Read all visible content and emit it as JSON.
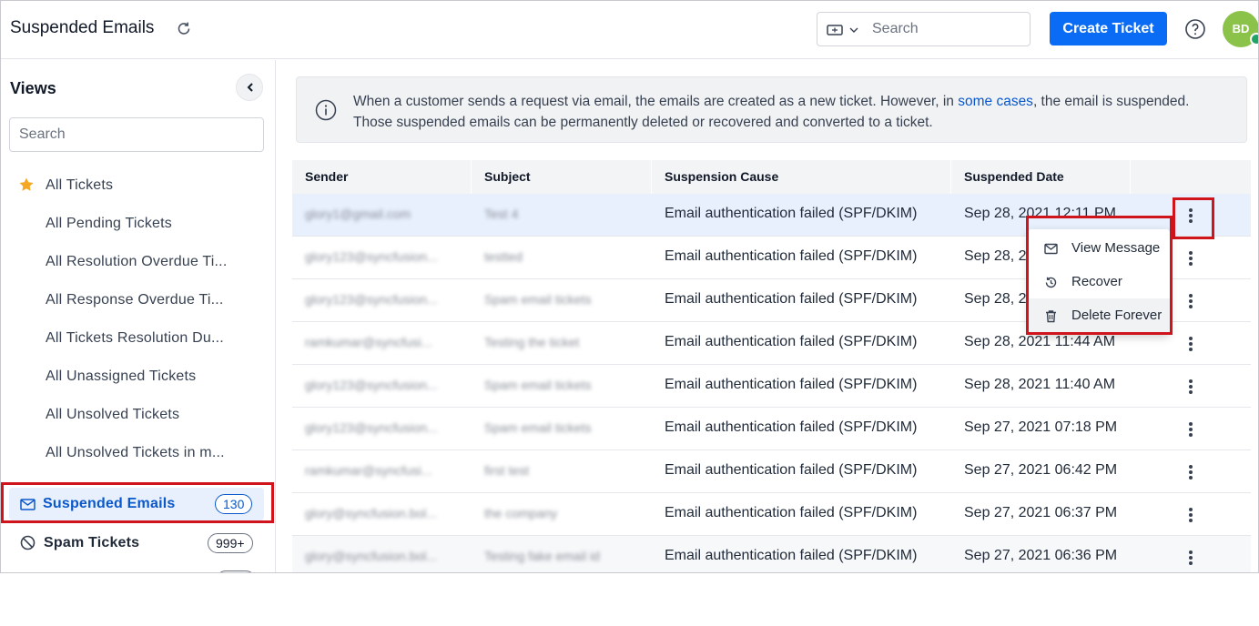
{
  "header": {
    "title": "Suspended Emails",
    "search_placeholder": "Search",
    "create_ticket_label": "Create Ticket",
    "avatar_initials": "BD"
  },
  "sidebar": {
    "views_title": "Views",
    "search_placeholder": "Search",
    "items": [
      {
        "label": "All Tickets"
      },
      {
        "label": "All Pending Tickets"
      },
      {
        "label": "All Resolution Overdue Ti..."
      },
      {
        "label": "All Response Overdue Ti..."
      },
      {
        "label": "All Tickets Resolution Du..."
      },
      {
        "label": "All Unassigned Tickets"
      },
      {
        "label": "All Unsolved Tickets"
      },
      {
        "label": "All Unsolved Tickets in m..."
      }
    ],
    "suspended": {
      "label": "Suspended Emails",
      "count": "130"
    },
    "spam": {
      "label": "Spam Tickets",
      "count": "999+"
    }
  },
  "info": {
    "text_before": "When a customer sends a request via email, the emails are created as a new ticket. However, in ",
    "link_text": "some cases",
    "text_after": ", the email is suspended. Those suspended emails can be permanently deleted or recovered and converted to a ticket."
  },
  "table": {
    "headers": {
      "sender": "Sender",
      "subject": "Subject",
      "cause": "Suspension Cause",
      "date": "Suspended Date"
    },
    "rows": [
      {
        "sender": "glory1@gmail.com",
        "subject": "Test 4",
        "cause": "Email authentication failed (SPF/DKIM)",
        "date": "Sep 28, 2021 12:11 PM"
      },
      {
        "sender": "glory123@syncfusion...",
        "subject": "testted",
        "cause": "Email authentication failed (SPF/DKIM)",
        "date": "Sep 28, 2021 12:05 PM"
      },
      {
        "sender": "glory123@syncfusion...",
        "subject": "Spam email tickets",
        "cause": "Email authentication failed (SPF/DKIM)",
        "date": "Sep 28, 2021 11:52 AM"
      },
      {
        "sender": "ramkumar@syncfusi...",
        "subject": "Testing the ticket",
        "cause": "Email authentication failed (SPF/DKIM)",
        "date": "Sep 28, 2021 11:44 AM"
      },
      {
        "sender": "glory123@syncfusion...",
        "subject": "Spam email tickets",
        "cause": "Email authentication failed (SPF/DKIM)",
        "date": "Sep 28, 2021 11:40 AM"
      },
      {
        "sender": "glory123@syncfusion...",
        "subject": "Spam email tickets",
        "cause": "Email authentication failed (SPF/DKIM)",
        "date": "Sep 27, 2021 07:18 PM"
      },
      {
        "sender": "ramkumar@syncfusi...",
        "subject": "first test",
        "cause": "Email authentication failed (SPF/DKIM)",
        "date": "Sep 27, 2021 06:42 PM"
      },
      {
        "sender": "glory@syncfusion.bol...",
        "subject": "the company",
        "cause": "Email authentication failed (SPF/DKIM)",
        "date": "Sep 27, 2021 06:37 PM"
      },
      {
        "sender": "glory@syncfusion.bol...",
        "subject": "Testing fake email id",
        "cause": "Email authentication failed (SPF/DKIM)",
        "date": "Sep 27, 2021 06:36 PM"
      }
    ]
  },
  "menu": {
    "items": [
      {
        "label": "View Message",
        "icon": "mail-icon"
      },
      {
        "label": "Recover",
        "icon": "history-icon"
      },
      {
        "label": "Delete Forever",
        "icon": "trash-icon"
      }
    ]
  },
  "colors": {
    "accent": "#0a6cf5",
    "highlight_box": "#d0141b",
    "avatar": "#8bc34a"
  }
}
